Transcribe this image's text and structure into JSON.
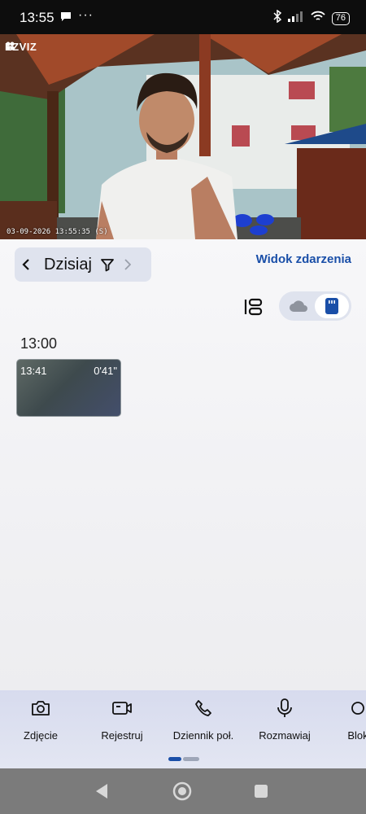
{
  "status_bar": {
    "time": "13:55",
    "dots": "···",
    "battery": "76"
  },
  "camera": {
    "logo": "EZVIZ",
    "timestamp": "03-09-2026 13:55:35 (S)"
  },
  "date_nav": {
    "label": "Dzisiaj"
  },
  "event_view_link": "Widok zdarzenia",
  "timeline": {
    "hour_header": "13:00",
    "clips": [
      {
        "time": "13:41",
        "duration": "0'41\""
      }
    ]
  },
  "toolbar": {
    "items": [
      {
        "label": "Zdjęcie",
        "icon": "camera-icon"
      },
      {
        "label": "Rejestruj",
        "icon": "video-record-icon"
      },
      {
        "label": "Dziennik poł.",
        "icon": "phone-icon"
      },
      {
        "label": "Rozmawiaj",
        "icon": "microphone-icon"
      },
      {
        "label": "Blok",
        "icon": "lock-icon"
      }
    ]
  },
  "colors": {
    "accent": "#1a4fa8",
    "toolbar_bg": "#d7dbee",
    "toggle_bg": "#dfe3ee"
  }
}
